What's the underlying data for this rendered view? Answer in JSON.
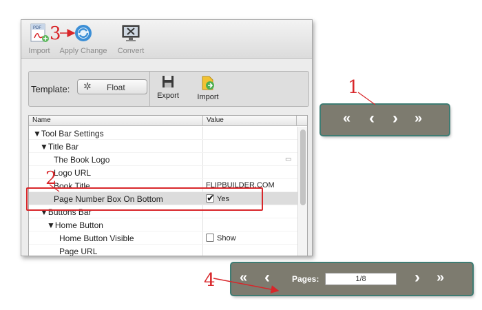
{
  "toolbar": {
    "import_label": "Import",
    "apply_change_label": "Apply Change",
    "convert_label": "Convert",
    "import_file_badge": "PDF"
  },
  "template_bar": {
    "label": "Template:",
    "float_button": "Float",
    "export_label": "Export",
    "import_label": "Import"
  },
  "grid": {
    "col_name": "Name",
    "col_value": "Value",
    "rows": [
      {
        "name": "▼Tool Bar Settings",
        "value": ""
      },
      {
        "name": "▼Title Bar",
        "value": ""
      },
      {
        "name": "The Book Logo",
        "value": ""
      },
      {
        "name": "Logo URL",
        "value": ""
      },
      {
        "name": "Book Title",
        "value": "FLIPBUILDER.COM"
      },
      {
        "name": "Page Number Box On Bottom",
        "value": "Yes",
        "checked": true
      },
      {
        "name": "▼Buttons Bar",
        "value": ""
      },
      {
        "name": "▼Home Button",
        "value": ""
      },
      {
        "name": "Home Button Visible",
        "value": "Show",
        "checked": false
      },
      {
        "name": "Page URL",
        "value": ""
      }
    ]
  },
  "nav_small": {
    "first_icon": "«",
    "prev_icon": "‹",
    "next_icon": "›",
    "last_icon": "»"
  },
  "nav_large": {
    "first_icon": "«",
    "prev_icon": "‹",
    "pages_label": "Pages:",
    "page_value": "1/8",
    "next_icon": "›",
    "last_icon": "»"
  },
  "annotations": {
    "n1": "1",
    "n2": "2",
    "n3": "3",
    "n4": "4"
  },
  "colors": {
    "nav_bg": "#7d7b6f",
    "nav_border": "#3e7c73",
    "annotation_red": "#d8262a",
    "selected_row": "#dcdcdc"
  }
}
